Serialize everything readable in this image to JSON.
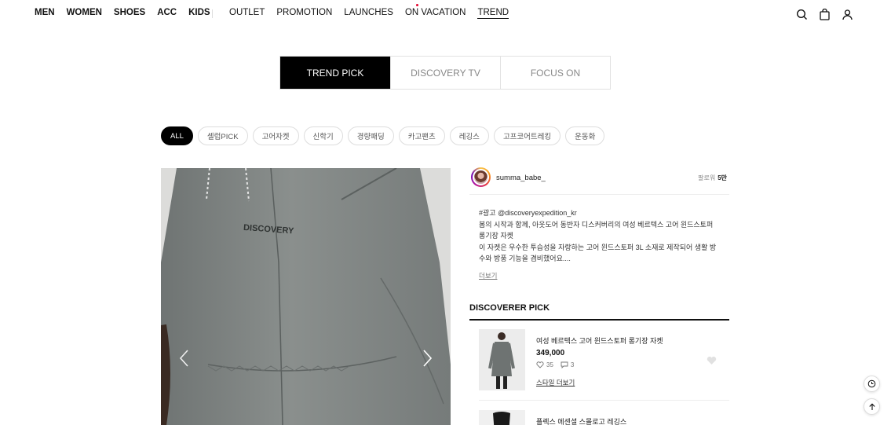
{
  "header": {
    "primary_nav": [
      "MEN",
      "WOMEN",
      "SHOES",
      "ACC",
      "KIDS"
    ],
    "secondary_nav": [
      "OUTLET",
      "PROMOTION",
      "LAUNCHES",
      "ON VACATION",
      "TREND"
    ],
    "active_secondary": "TREND",
    "icons": [
      "search-icon",
      "shopping-bag-icon",
      "user-icon"
    ]
  },
  "tabs": [
    "TREND PICK",
    "DISCOVERY TV",
    "FOCUS ON"
  ],
  "active_tab": "TREND PICK",
  "chips": [
    "ALL",
    "셀럽PICK",
    "고어자켓",
    "신학기",
    "경량패딩",
    "카고팬츠",
    "레깅스",
    "고프코어트레킹",
    "운동화"
  ],
  "active_chip": "ALL",
  "post": {
    "username": "summa_babe_",
    "followers_label": "팔로워",
    "followers_count": "5만",
    "caption_lines": [
      "#광고 @discoveryexpedition_kr",
      "봄의 시작과 함께, 아웃도어 동반자 디스커버리의 여성 베르텍스 고어 윈드스토퍼",
      "롱기장 자켓",
      "이 자켓은 우수한 투습성을 자랑하는 고어 윈드스토퍼 3L 소재로 제작되어 생활 방",
      "수와 방풍 기능을 겸비했어요...."
    ],
    "more_label": "더보기",
    "image_logo_text": "DISCOVERY"
  },
  "discoverer_pick": {
    "title": "DISCOVERER PICK",
    "items": [
      {
        "name": "여성 베르텍스 고어 윈드스토퍼 롱기장 자켓",
        "price": "349,000",
        "likes": "35",
        "comments": "3",
        "style_more": "스타일 더보기"
      },
      {
        "name": "플렉스 에센셜 스몰로고 레깅스"
      }
    ]
  },
  "colors": {
    "accent": "#000000",
    "notice_dot": "#e4002b"
  }
}
